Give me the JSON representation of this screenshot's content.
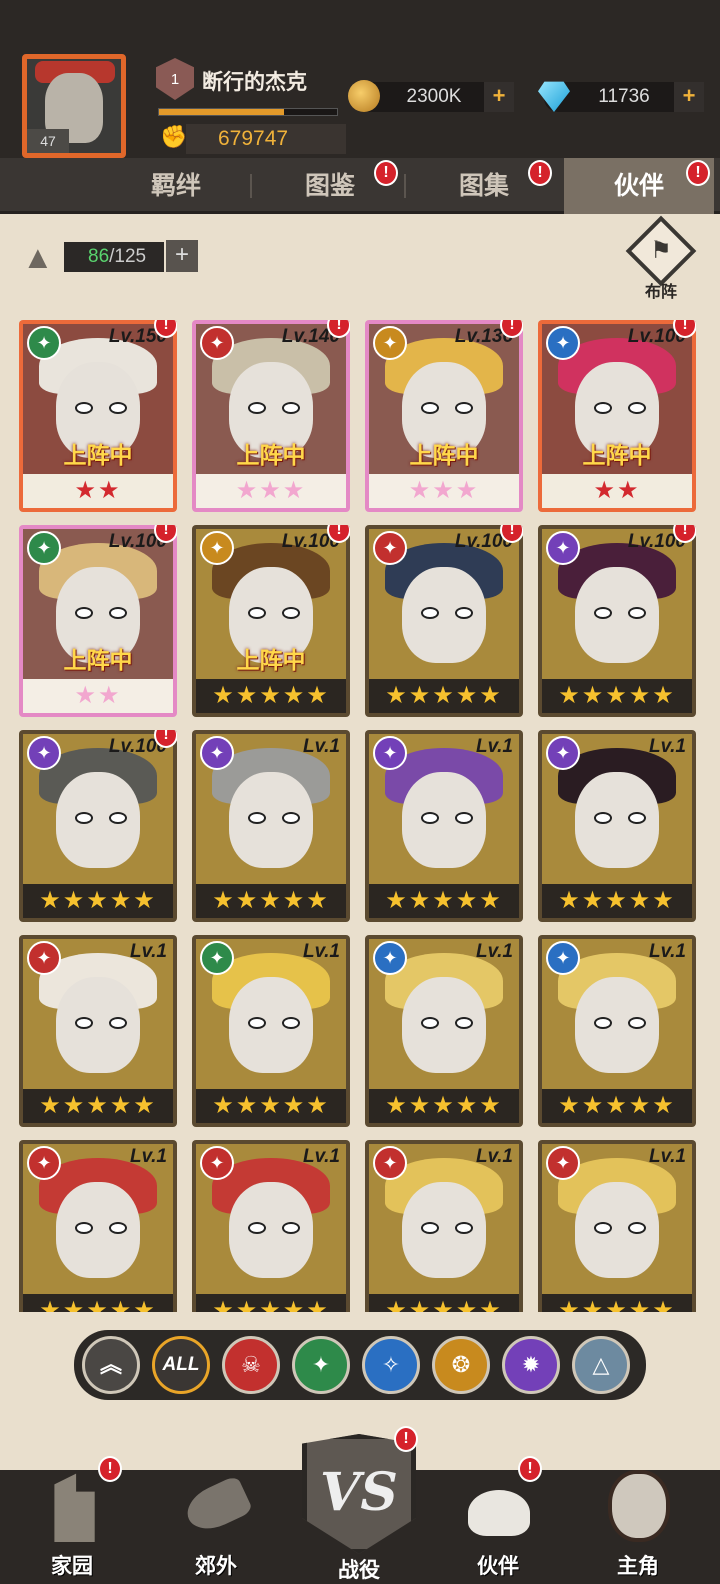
{
  "player": {
    "name": "断行的杰克",
    "level": "47",
    "rank": "1",
    "power": "679747",
    "xp_fraction": 0.7
  },
  "currency": {
    "gold": "2300K",
    "gems": "11736",
    "plus": "+"
  },
  "tabs": [
    {
      "label": "羁绊",
      "alert": false
    },
    {
      "label": "图鉴",
      "alert": true
    },
    {
      "label": "图集",
      "alert": true
    },
    {
      "label": "伙伴",
      "alert": true,
      "active": true
    }
  ],
  "alert_glyph": "!",
  "roster": {
    "count_current": "86",
    "count_total": "/125",
    "plus": "+",
    "formation_label": "布阵"
  },
  "on_team_label": "上阵中",
  "cards": [
    {
      "lv": "Lv.150",
      "stars": 2,
      "frame": "red",
      "element": "green",
      "on_team": true,
      "alert": true,
      "hair": "#e9e4dc"
    },
    {
      "lv": "Lv.140",
      "stars": 3,
      "frame": "pink",
      "element": "red",
      "on_team": true,
      "alert": true,
      "hair": "#c9bfa8"
    },
    {
      "lv": "Lv.136",
      "stars": 3,
      "frame": "pink",
      "element": "gold",
      "on_team": true,
      "alert": true,
      "hair": "#e3b54a"
    },
    {
      "lv": "Lv.100",
      "stars": 2,
      "frame": "red",
      "element": "blue",
      "on_team": true,
      "alert": true,
      "hair": "#d0325f"
    },
    {
      "lv": "Lv.100",
      "stars": 2,
      "frame": "pink",
      "element": "green",
      "on_team": true,
      "alert": true,
      "hair": "#d8b77a"
    },
    {
      "lv": "Lv.100",
      "stars": 5,
      "frame": "gold",
      "element": "gold",
      "on_team": true,
      "alert": true,
      "hair": "#6b4622"
    },
    {
      "lv": "Lv.100",
      "stars": 5,
      "frame": "gold",
      "element": "red",
      "on_team": false,
      "alert": true,
      "hair": "#2f3c55"
    },
    {
      "lv": "Lv.100",
      "stars": 5,
      "frame": "gold",
      "element": "purple",
      "on_team": false,
      "alert": true,
      "hair": "#4a1f3a"
    },
    {
      "lv": "Lv.100",
      "stars": 5,
      "frame": "gold",
      "element": "purple",
      "on_team": false,
      "alert": true,
      "hair": "#5a5a55"
    },
    {
      "lv": "Lv.1",
      "stars": 5,
      "frame": "gold",
      "element": "purple",
      "on_team": false,
      "alert": false,
      "hair": "#9b9b98"
    },
    {
      "lv": "Lv.1",
      "stars": 5,
      "frame": "gold",
      "element": "purple",
      "on_team": false,
      "alert": false,
      "hair": "#7a4aa8"
    },
    {
      "lv": "Lv.1",
      "stars": 5,
      "frame": "gold",
      "element": "purple",
      "on_team": false,
      "alert": false,
      "hair": "#2a1c22"
    },
    {
      "lv": "Lv.1",
      "stars": 5,
      "frame": "gold",
      "element": "red",
      "on_team": false,
      "alert": false,
      "hair": "#ece6dc"
    },
    {
      "lv": "Lv.1",
      "stars": 5,
      "frame": "gold",
      "element": "green",
      "on_team": false,
      "alert": false,
      "hair": "#e6c24a"
    },
    {
      "lv": "Lv.1",
      "stars": 5,
      "frame": "gold",
      "element": "blue",
      "on_team": false,
      "alert": false,
      "hair": "#e4c766"
    },
    {
      "lv": "Lv.1",
      "stars": 5,
      "frame": "gold",
      "element": "blue",
      "on_team": false,
      "alert": false,
      "hair": "#e4c766"
    },
    {
      "lv": "Lv.1",
      "stars": 5,
      "frame": "gold",
      "element": "red",
      "on_team": false,
      "alert": false,
      "hair": "#c43a34"
    },
    {
      "lv": "Lv.1",
      "stars": 5,
      "frame": "gold",
      "element": "red",
      "on_team": false,
      "alert": false,
      "hair": "#c43a34"
    },
    {
      "lv": "Lv.1",
      "stars": 5,
      "frame": "gold",
      "element": "red",
      "on_team": false,
      "alert": false,
      "hair": "#e3c25a"
    },
    {
      "lv": "Lv.1",
      "stars": 5,
      "frame": "gold",
      "element": "red",
      "on_team": false,
      "alert": false,
      "hair": "#e3c25a"
    }
  ],
  "filters": [
    {
      "name": "upgrade-filter",
      "label": "",
      "color": "#4a4744",
      "glyph": "︽"
    },
    {
      "name": "all-filter",
      "label": "ALL",
      "color": "#3a3633",
      "glyph": "ALL"
    },
    {
      "name": "red-element-filter",
      "label": "",
      "color": "#c2302e",
      "glyph": "☠"
    },
    {
      "name": "green-element-filter",
      "label": "",
      "color": "#2e8a4a",
      "glyph": "✦"
    },
    {
      "name": "blue-element-filter",
      "label": "",
      "color": "#2a6fc2",
      "glyph": "✧"
    },
    {
      "name": "gold-element-filter",
      "label": "",
      "color": "#c88a1e",
      "glyph": "❂"
    },
    {
      "name": "purple-element-filter",
      "label": "",
      "color": "#7340b8",
      "glyph": "✹"
    },
    {
      "name": "grey-element-filter",
      "label": "",
      "color": "#6d8aa0",
      "glyph": "△"
    }
  ],
  "nav": [
    {
      "label": "家园",
      "alert": true
    },
    {
      "label": "郊外",
      "alert": false
    },
    {
      "label": "战役",
      "alert": true
    },
    {
      "label": "伙伴",
      "alert": true
    },
    {
      "label": "主角",
      "alert": false
    }
  ],
  "element_colors": {
    "green": "#2e8a4a",
    "red": "#c2302e",
    "gold": "#c88a1e",
    "blue": "#2a6fc2",
    "purple": "#7340b8"
  }
}
